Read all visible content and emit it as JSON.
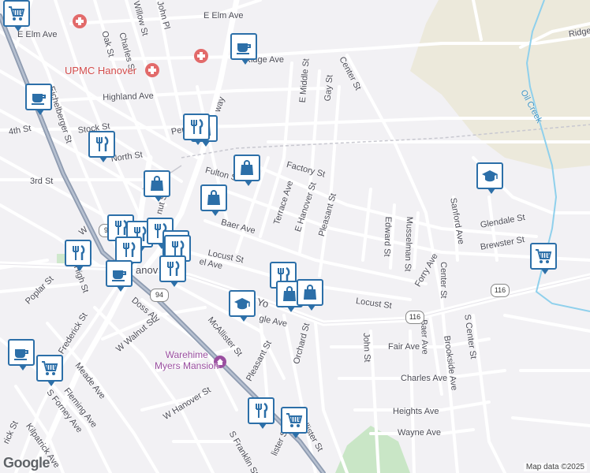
{
  "attribution": "Map data ©2025",
  "logo": "Google",
  "poi": {
    "hospital_name": "UPMC Hanover",
    "mansion_name_line1": "Warehime",
    "mansion_name_line2": "Myers Mansion",
    "creek_name": "Oil Creek",
    "town_name": "Hanover"
  },
  "route_shields": [
    "94",
    "116",
    "116",
    "94"
  ],
  "streets": [
    {
      "id": "e-elm-ave-east",
      "text": "E Elm Ave"
    },
    {
      "id": "e-elm-ave-west",
      "text": "E Elm Ave"
    },
    {
      "id": "willow-st",
      "text": "Willow St"
    },
    {
      "id": "john-pl",
      "text": "John Pl"
    },
    {
      "id": "oak-st",
      "text": "Oak St"
    },
    {
      "id": "charles-st-north",
      "text": "Charles St"
    },
    {
      "id": "ridge-ave-west",
      "text": "Ridge Ave"
    },
    {
      "id": "ridge-ave-east",
      "text": "Ridge"
    },
    {
      "id": "e-middle-st",
      "text": "E Middle St"
    },
    {
      "id": "gay-st",
      "text": "Gay St"
    },
    {
      "id": "center-st-north",
      "text": "Center St"
    },
    {
      "id": "highland-ave",
      "text": "Highland Ave"
    },
    {
      "id": "eichelberger-st",
      "text": "Eichelberger St"
    },
    {
      "id": "4th-st",
      "text": "4th St"
    },
    {
      "id": "stock-st",
      "text": "Stock St"
    },
    {
      "id": "penn-st",
      "text": "Penn St"
    },
    {
      "id": "broadway",
      "text": "way"
    },
    {
      "id": "north-st",
      "text": "North St"
    },
    {
      "id": "factory-st",
      "text": "Factory St"
    },
    {
      "id": "fulton-st",
      "text": "Fulton St"
    },
    {
      "id": "3rd-st",
      "text": "3rd St"
    },
    {
      "id": "terrace-ave",
      "text": "Terrace Ave"
    },
    {
      "id": "e-hanover-st",
      "text": "E Hanover St"
    },
    {
      "id": "pleasant-st-north",
      "text": "Pleasant St"
    },
    {
      "id": "glendale-st",
      "text": "Glendale St"
    },
    {
      "id": "sanford-ave",
      "text": "Sanford Ave"
    },
    {
      "id": "edward-st",
      "text": "Edward St"
    },
    {
      "id": "musselman-st",
      "text": "Musselman St"
    },
    {
      "id": "brewster-st",
      "text": "Brewster St"
    },
    {
      "id": "forry-ave",
      "text": "Forry Ave"
    },
    {
      "id": "center-st",
      "text": "Center St"
    },
    {
      "id": "baer-ave-north",
      "text": "Baer Ave"
    },
    {
      "id": "locust-st-west",
      "text": "Locust St"
    },
    {
      "id": "carlisle-st",
      "text": "nut St"
    },
    {
      "id": "high-st",
      "text": "High St"
    },
    {
      "id": "poplar-st",
      "text": "Poplar St"
    },
    {
      "id": "walnut-st-north",
      "text": "W"
    },
    {
      "id": "york-st",
      "text": "Yo"
    },
    {
      "id": "hanover-label-partial",
      "text": "anov"
    },
    {
      "id": "el-ave",
      "text": "el Ave"
    },
    {
      "id": "locust-st-east",
      "text": "Locust St"
    },
    {
      "id": "doss-aly",
      "text": "Doss Aly"
    },
    {
      "id": "w-walnut-st",
      "text": "W Walnut St"
    },
    {
      "id": "frederick-st",
      "text": "Frederick St"
    },
    {
      "id": "mcallister-st",
      "text": "McAllister St"
    },
    {
      "id": "eagle-ave",
      "text": "gle Ave"
    },
    {
      "id": "orchard-st",
      "text": "Orchard St"
    },
    {
      "id": "john-st",
      "text": "John St"
    },
    {
      "id": "fair-ave",
      "text": "Fair Ave"
    },
    {
      "id": "baer-ave",
      "text": "Baer Ave"
    },
    {
      "id": "brookside-ave",
      "text": "Brookside Ave"
    },
    {
      "id": "s-center-st",
      "text": "S Center St"
    },
    {
      "id": "charles-ave",
      "text": "Charles Ave"
    },
    {
      "id": "heights-ave",
      "text": "Heights Ave"
    },
    {
      "id": "wayne-ave",
      "text": "Wayne Ave"
    },
    {
      "id": "meade-ave",
      "text": "Meade Ave"
    },
    {
      "id": "fleming-ave",
      "text": "Fleming Ave"
    },
    {
      "id": "s-forney-ave",
      "text": "S Forney Ave"
    },
    {
      "id": "kilpatrick-ave",
      "text": "Kilpatrick Ave"
    },
    {
      "id": "rick-st",
      "text": "rick St"
    },
    {
      "id": "pleasant-st-south",
      "text": "Pleasant St"
    },
    {
      "id": "w-hanover-st",
      "text": "W Hanover St"
    },
    {
      "id": "s-franklin-st",
      "text": "S Franklin St"
    },
    {
      "id": "mcallister-south",
      "text": "lister St"
    },
    {
      "id": "allister-st",
      "text": "llister St"
    }
  ],
  "markers": [
    {
      "id": "cafe-ridge-ave",
      "kind": "coffee-icon"
    },
    {
      "id": "cafe-eichelberger",
      "kind": "coffee-icon"
    },
    {
      "id": "shop-penn-st",
      "kind": "shopping-bag-icon"
    },
    {
      "id": "restaurant-penn-st",
      "kind": "restaurant-icon"
    },
    {
      "id": "restaurant-stock-st",
      "kind": "restaurant-icon"
    },
    {
      "id": "shop-fulton-st",
      "kind": "shopping-bag-icon"
    },
    {
      "id": "shop-baer-ave",
      "kind": "shopping-bag-icon"
    },
    {
      "id": "shop-carlisle-st",
      "kind": "shopping-bag-icon"
    },
    {
      "id": "school-east",
      "kind": "school-icon"
    },
    {
      "id": "grocery-brewster",
      "kind": "cart-icon"
    },
    {
      "id": "restaurant-high-st",
      "kind": "restaurant-icon"
    },
    {
      "id": "restaurant-square-1",
      "kind": "restaurant-icon"
    },
    {
      "id": "restaurant-square-2",
      "kind": "restaurant-icon"
    },
    {
      "id": "restaurant-square-3",
      "kind": "restaurant-icon"
    },
    {
      "id": "shop-square",
      "kind": "shopping-bag-icon"
    },
    {
      "id": "restaurant-square-4",
      "kind": "restaurant-icon"
    },
    {
      "id": "cafe-square",
      "kind": "coffee-icon"
    },
    {
      "id": "restaurant-square-5",
      "kind": "restaurant-icon"
    },
    {
      "id": "restaurant-locust",
      "kind": "restaurant-icon"
    },
    {
      "id": "restaurant-york-1",
      "kind": "restaurant-icon"
    },
    {
      "id": "shop-york-1",
      "kind": "shopping-bag-icon"
    },
    {
      "id": "shop-york-2",
      "kind": "shopping-bag-icon"
    },
    {
      "id": "school-eagle",
      "kind": "school-icon"
    },
    {
      "id": "cafe-frederick",
      "kind": "coffee-icon"
    },
    {
      "id": "grocery-meade",
      "kind": "cart-icon"
    },
    {
      "id": "restaurant-franklin",
      "kind": "restaurant-icon"
    },
    {
      "id": "grocery-mcallister",
      "kind": "cart-icon"
    },
    {
      "id": "grocery-top-left",
      "kind": "cart-icon"
    }
  ]
}
